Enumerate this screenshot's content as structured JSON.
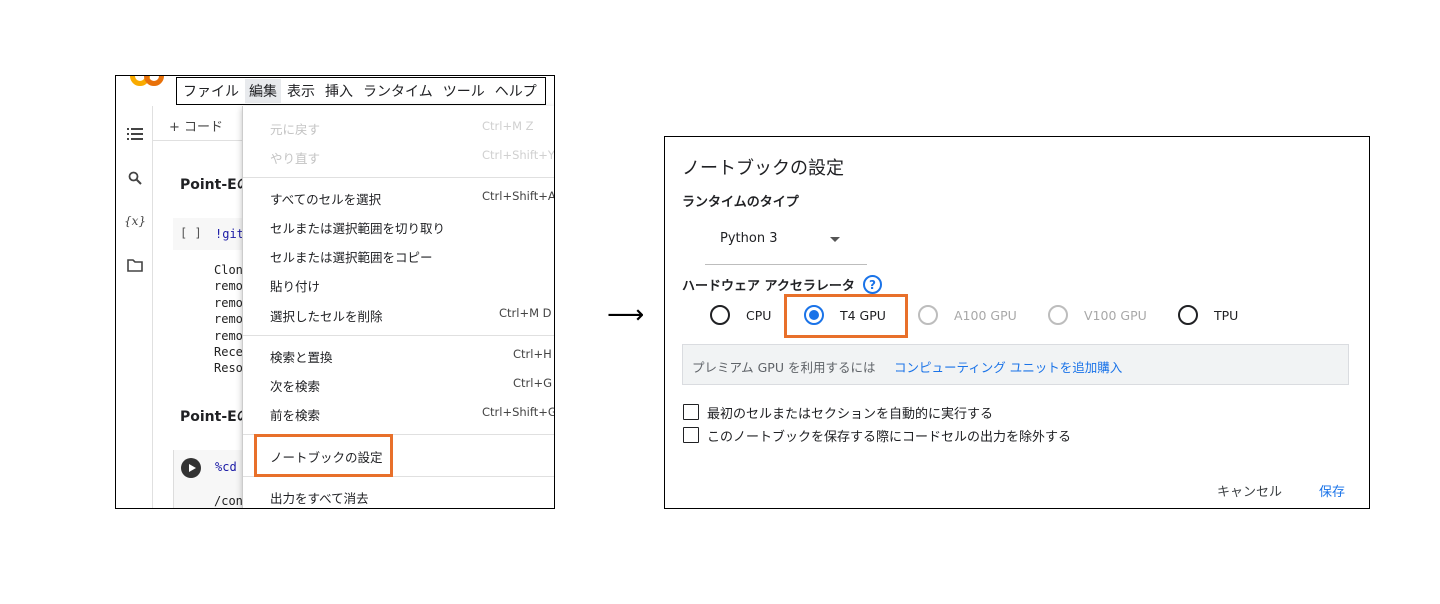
{
  "colors": {
    "highlight": "#e8702a",
    "accent": "#1a73e8"
  },
  "left": {
    "menubar": [
      "ファイル",
      "編集",
      "表示",
      "挿入",
      "ランタイム",
      "ツール",
      "ヘルプ"
    ],
    "add_code": "+ コード",
    "headings": [
      "Point-Eの",
      "Point-Eの"
    ],
    "cell1_bracket": "[ ]",
    "cell1_code": "!git",
    "output_lines": [
      "Clon",
      "remo",
      "remo",
      "remo",
      "remo",
      "Rece",
      "Reso"
    ],
    "cell2_code": "%cd",
    "cell2_output": "/con",
    "edit_menu": [
      {
        "label": "元に戻す",
        "shortcut": "Ctrl+M Z"
      },
      {
        "label": "やり直す",
        "shortcut": "Ctrl+Shift+Y"
      },
      {
        "label": "すべてのセルを選択",
        "shortcut": "Ctrl+Shift+A"
      },
      {
        "label": "セルまたは選択範囲を切り取り",
        "shortcut": ""
      },
      {
        "label": "セルまたは選択範囲をコピー",
        "shortcut": ""
      },
      {
        "label": "貼り付け",
        "shortcut": ""
      },
      {
        "label": "選択したセルを削除",
        "shortcut": "Ctrl+M D"
      },
      {
        "label": "検索と置換",
        "shortcut": "Ctrl+H"
      },
      {
        "label": "次を検索",
        "shortcut": "Ctrl+G"
      },
      {
        "label": "前を検索",
        "shortcut": "Ctrl+Shift+G"
      },
      {
        "label": "ノートブックの設定",
        "shortcut": ""
      },
      {
        "label": "出力をすべて消去",
        "shortcut": ""
      }
    ]
  },
  "arrow": "⟶",
  "dialog": {
    "title": "ノートブックの設定",
    "runtime_label": "ランタイムのタイプ",
    "runtime_value": "Python 3",
    "accelerator_label": "ハードウェア アクセラレータ",
    "help_glyph": "?",
    "accelerators": [
      {
        "label": "CPU",
        "state": "unchecked"
      },
      {
        "label": "T4 GPU",
        "state": "checked"
      },
      {
        "label": "A100 GPU",
        "state": "disabled"
      },
      {
        "label": "V100 GPU",
        "state": "disabled"
      },
      {
        "label": "TPU",
        "state": "unchecked"
      }
    ],
    "promo_text": "プレミアム GPU を利用するには",
    "promo_link": "コンピューティング ユニットを追加購入",
    "checkbox1": "最初のセルまたはセクションを自動的に実行する",
    "checkbox2": "このノートブックを保存する際にコードセルの出力を除外する",
    "cancel": "キャンセル",
    "save": "保存"
  }
}
